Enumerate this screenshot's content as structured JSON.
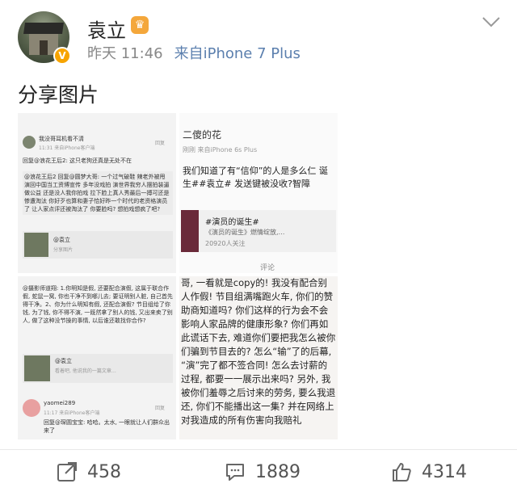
{
  "header": {
    "username": "袁立",
    "time": "昨天 11:46",
    "source": "来自iPhone 7 Plus",
    "verified_badge": "V"
  },
  "post": {
    "caption": "分享图片"
  },
  "images": {
    "img1": {
      "user": "我没哥耳机看不清",
      "source": "11:31 来自iPhone客户端",
      "reply": "回复",
      "text1": "回复@浪花王后2: 这只老狗还真是无处不在",
      "text2": "@浪花王后2 回复@圆梦大哥: 一个过气破鞋 辣老外被甩 演回中国当工资博宣传 多年没戏拍 演世界我穷人摆拍装逼做公益 还是没人我你拍戏 拉下脸上真人秀最后一搏可还是惨遭淘汰 你好歹也算和妻子恰好昨一个时代的老资格演员了 让人家点评还被淘汰了 你要脸吗? 想拍戏想疯了吧?",
      "quote_user": "@袁立",
      "quote_text": "分享图片"
    },
    "img2": {
      "name": "二傻的花",
      "time": "刚刚 来自iPhone 6s Plus",
      "body": "我们知道了有“信仰”的人是多么仁 诞生##袁立# 发送键被没收?智障",
      "card_title": "#演员的诞生#",
      "card_desc": "《演员的诞生》燃情绽放,…",
      "card_follow": "20920人关注",
      "action": "评论"
    },
    "img3": {
      "text1": "@摄影师道翔: 1.你明知是假, 还要配合演假, 这属于联合作假, 蛇鼠一窝, 你也干净不到哪儿去; 要证明别人脏, 自己首先得干净。2、你为什么明知有假, 还配合演假? 节目组给了你钱, 为了钱, 你不得不演, 一既然拿了别人的钱, 又出来卖了别人, 做了这种没节操的事情, 以后谁还敢找你合作?",
      "quote_user": "@袁立",
      "quote_text": "看着吧, 他说我的一篇文章…",
      "user2": "yaomei289",
      "time2": "11:17 来自iPhone客户端",
      "reply2": "回复@琛圆宝宝: 哈哈。太水, 一眼就让人们群众出来了",
      "reply_btn": "回复"
    },
    "img4": {
      "body": "哥, 一看就是copy的! 我没有配合别人作假! 节目组满嘴跑火车, 你们的赞助商知道吗? 你们这样的行为会不会影响人家品牌的健康形象? 你们再如此谎话下去, 难道你们要把我怎么被你们骗到节目去的? 怎么“输”了的后幕, “演”完了都不签合同! 怎么去讨薪的过程, 都要一一展示出来吗? 另外, 我被你们羞辱之后讨来的劳务, 要么我退还, 你们不能播出这一集? 并在网络上对我造成的所有伤害向我赔礼"
    }
  },
  "actions": {
    "share_count": "458",
    "comment_count": "1889",
    "like_count": "4314"
  },
  "colors": {
    "accent_link": "#5b7fae",
    "badge": "#f7a400"
  }
}
